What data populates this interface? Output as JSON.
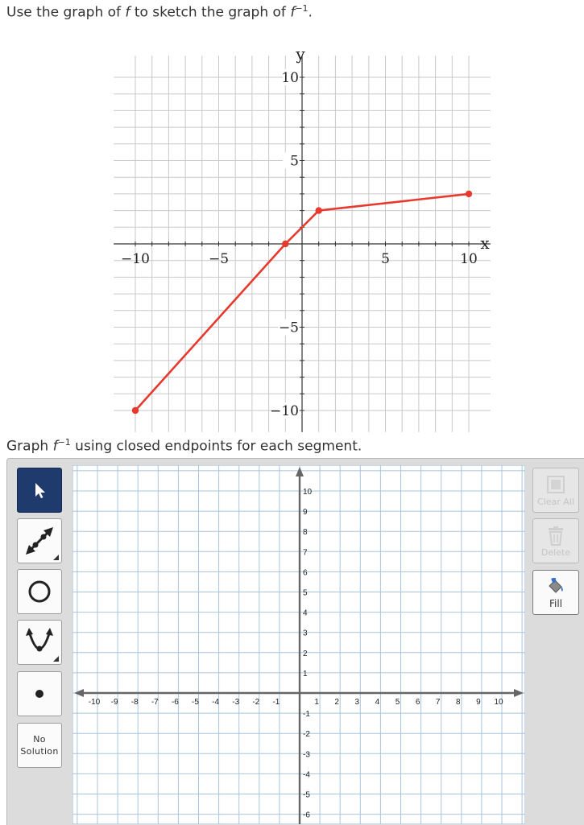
{
  "question": {
    "prefix": "Use the graph of ",
    "fn": "f",
    "middle": " to sketch the graph of ",
    "fn2": "f",
    "exponent": "−1",
    "suffix": "."
  },
  "chart_data": {
    "type": "line",
    "xlabel": "x",
    "ylabel": "y",
    "xlim": [
      -10.5,
      10.5
    ],
    "ylim": [
      -10.5,
      10.5
    ],
    "grid": true,
    "x_ticks": [
      -10,
      -5,
      5,
      10
    ],
    "y_ticks": [
      10,
      5,
      -5,
      -10
    ],
    "x_tick_labels": [
      "−10",
      "−5",
      "5",
      "10"
    ],
    "y_tick_labels": [
      "10",
      "5",
      "−5",
      "−10"
    ],
    "series": [
      {
        "points": [
          [
            -10,
            -10
          ],
          [
            -1,
            0
          ],
          [
            1,
            2
          ],
          [
            10,
            3
          ]
        ],
        "color": "#e8392f",
        "closed_endpoints": true
      }
    ]
  },
  "instruction": {
    "prefix": "Graph ",
    "fn": "f",
    "exponent": "−1",
    "suffix": " using closed endpoints for each segment."
  },
  "tools": {
    "select": {
      "icon": "arrow-pointer-icon"
    },
    "line": {
      "icon": "double-arrow-line-icon"
    },
    "circle": {
      "icon": "circle-icon"
    },
    "parabola": {
      "icon": "parabola-icon"
    },
    "point": {
      "icon": "dot-icon"
    },
    "no_solution": {
      "line1": "No",
      "line2": "Solution"
    }
  },
  "actions": {
    "clear_all": {
      "label": "Clear All",
      "icon": "clear-all-icon",
      "enabled": false
    },
    "delete": {
      "label": "Delete",
      "icon": "trash-icon",
      "enabled": false
    },
    "fill": {
      "label": "Fill",
      "icon": "paint-bucket-icon",
      "enabled": true
    }
  },
  "board": {
    "x_labels": [
      "-10",
      "-9",
      "-8",
      "-7",
      "-6",
      "-5",
      "-4",
      "-3",
      "-2",
      "-1",
      "1",
      "2",
      "3",
      "4",
      "5",
      "6",
      "7",
      "8",
      "9",
      "10"
    ],
    "y_labels_pos": [
      "10",
      "9",
      "8",
      "7",
      "6",
      "5",
      "4",
      "3",
      "2",
      "1"
    ],
    "y_labels_neg": [
      "-1",
      "-2",
      "-3",
      "-4",
      "-5",
      "-6"
    ],
    "colors": {
      "grid": "#a8c4de",
      "axis": "#666666",
      "background": "#ffffff"
    }
  }
}
